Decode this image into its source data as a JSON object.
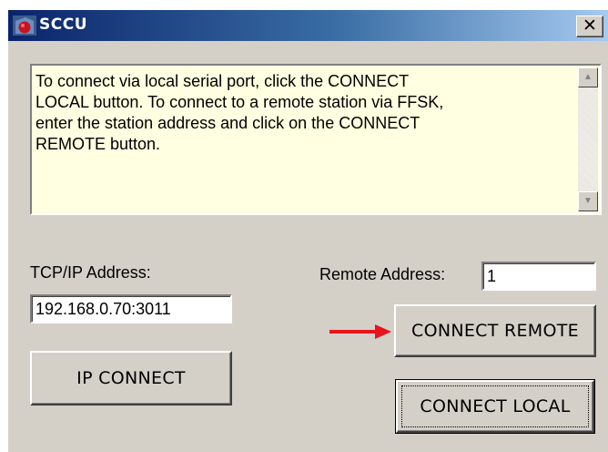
{
  "window": {
    "title": "SCCU",
    "close_glyph": "✕"
  },
  "info": {
    "text": "To connect via local serial port, click the CONNECT\nLOCAL button. To connect to a remote station via FFSK,\nenter the station address and click on the CONNECT\nREMOTE  button.",
    "scroll_up_glyph": "▲",
    "scroll_down_glyph": "▼"
  },
  "tcp": {
    "label": "TCP/IP Address:",
    "value": "192.168.0.70:3011"
  },
  "remote": {
    "label": "Remote Address:",
    "value": "1"
  },
  "buttons": {
    "ip_connect": "IP CONNECT",
    "connect_remote": "CONNECT REMOTE",
    "connect_local": "CONNECT LOCAL"
  },
  "colors": {
    "titlebar_start": "#0a246a",
    "info_background": "#ffffe1",
    "arrow": "#e8141c"
  }
}
